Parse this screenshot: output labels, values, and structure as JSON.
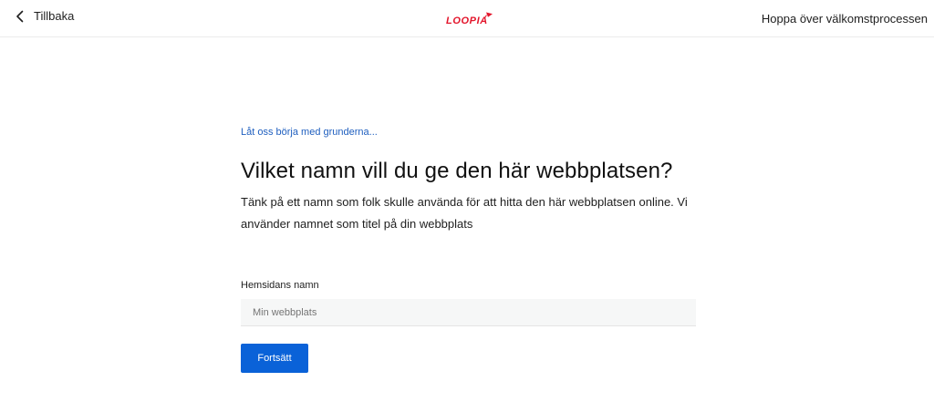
{
  "header": {
    "back_label": "Tillbaka",
    "logo_text": "LOOPIA",
    "skip_label": "Hoppa över välkomstprocessen",
    "brand_color": "#e3152b"
  },
  "main": {
    "eyebrow": "Låt oss börja med grunderna...",
    "heading": "Vilket namn vill du ge den här webbplatsen?",
    "description": "Tänk på ett namn som folk skulle använda för att hitta den här webbplatsen online. Vi använder namnet som titel på din webbplats",
    "field_label": "Hemsidans namn",
    "field_placeholder": "Min webbplats",
    "field_value": "",
    "continue_label": "Fortsätt",
    "accent_color": "#0a62d8"
  }
}
